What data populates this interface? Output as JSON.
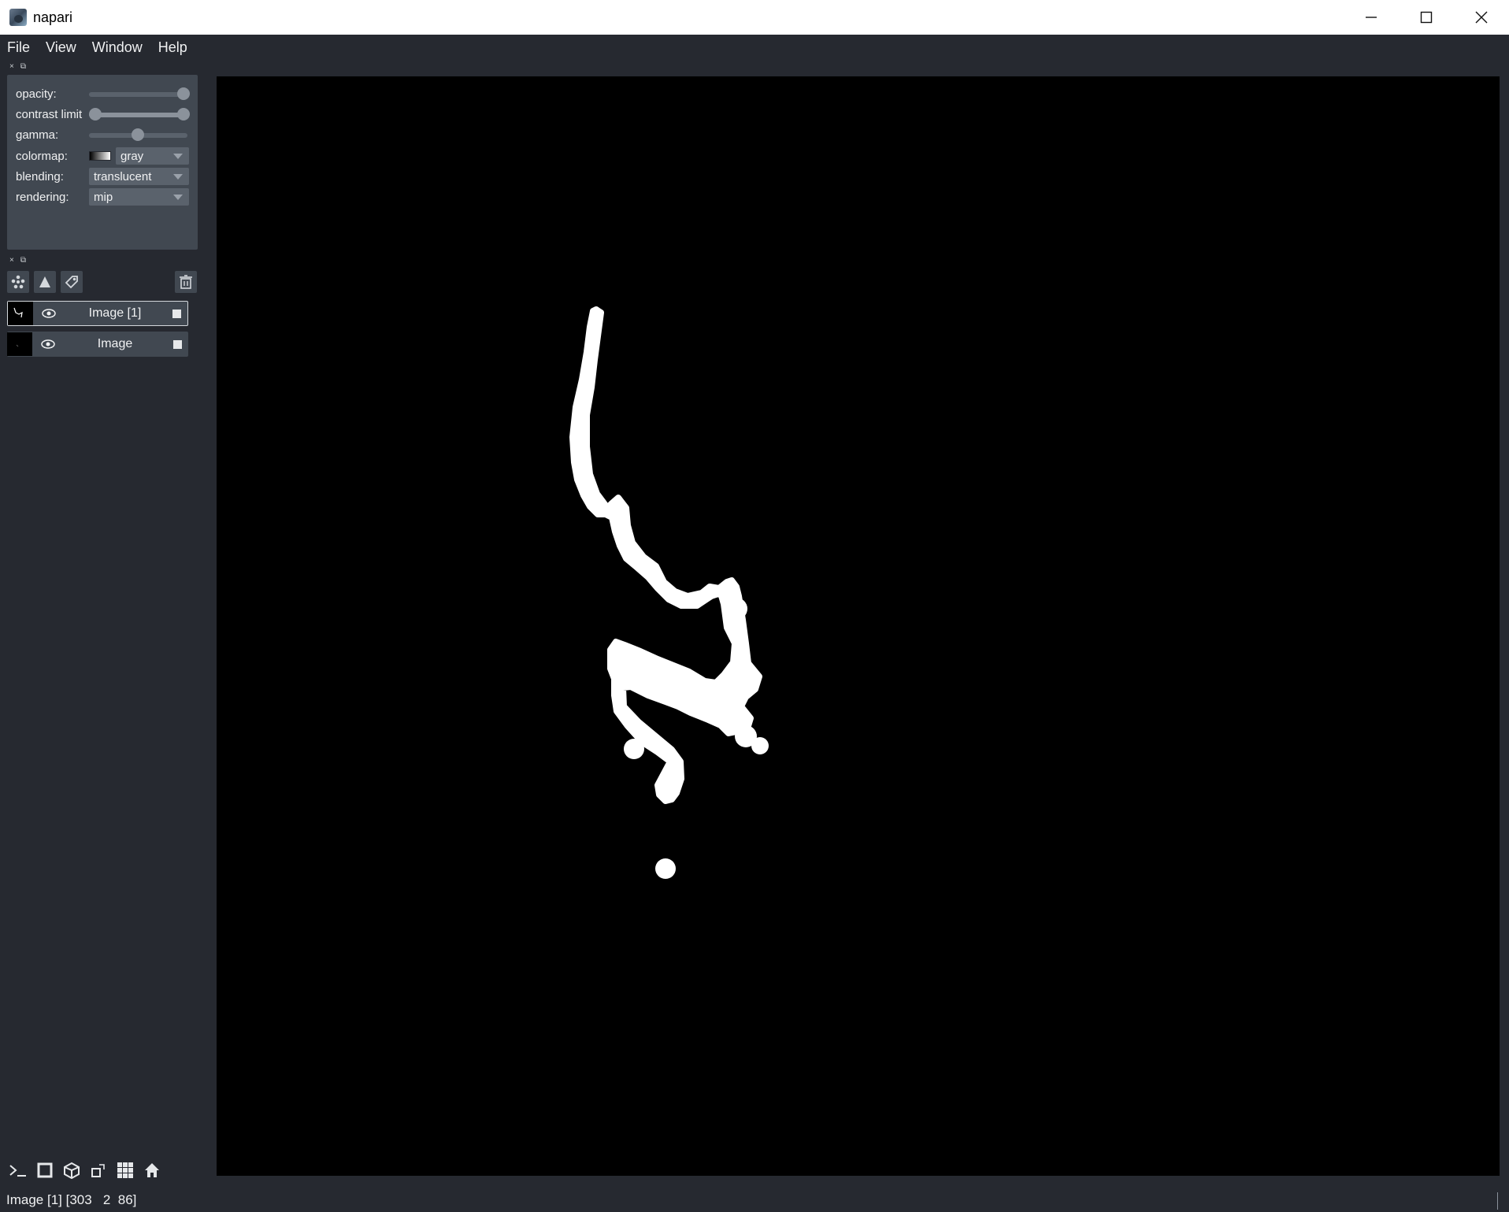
{
  "window": {
    "title": "napari",
    "minimize_label": "—",
    "maximize_label": "☐",
    "close_label": "✕"
  },
  "menu": {
    "items": [
      "File",
      "View",
      "Window",
      "Help"
    ]
  },
  "layer_controls": {
    "opacity_label": "opacity:",
    "opacity_value": 1.0,
    "contrast_label": "contrast limit",
    "contrast_range": [
      0.0,
      1.0
    ],
    "gamma_label": "gamma:",
    "gamma_value": 0.5,
    "colormap_label": "colormap:",
    "colormap_value": "gray",
    "blending_label": "blending:",
    "blending_value": "translucent",
    "rendering_label": "rendering:",
    "rendering_value": "mip"
  },
  "layer_tools": {
    "icons": [
      "points-icon",
      "shapes-icon",
      "labels-icon",
      "delete-icon"
    ]
  },
  "layers": [
    {
      "name": "Image [1]",
      "visible": true,
      "selected": true,
      "type_icon": "image-type-icon"
    },
    {
      "name": "Image",
      "visible": true,
      "selected": false,
      "type_icon": "image-type-icon"
    }
  ],
  "bottom_tools": {
    "icons": [
      "console-icon",
      "2d-3d-toggle-icon",
      "roll-dims-icon",
      "transpose-icon",
      "grid-icon",
      "home-icon"
    ]
  },
  "status": {
    "text": "Image [1] [303   2  86]"
  },
  "colors": {
    "background": "#262930",
    "panel": "#414851",
    "canvas": "#000000",
    "foreground": "#f0f1f2",
    "mask": "#ffffff"
  }
}
